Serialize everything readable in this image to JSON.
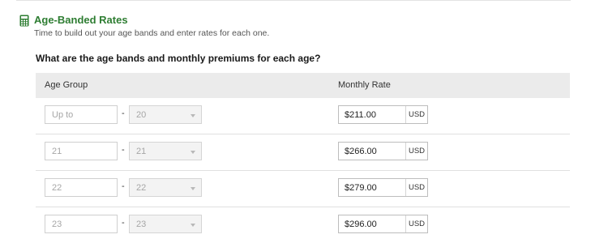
{
  "section": {
    "title": "Age-Banded Rates",
    "subtitle": "Time to build out your age bands and enter rates for each one.",
    "icon": "calculator-icon",
    "accent_color": "#2e7d32"
  },
  "question": "What are the age bands and monthly premiums for each age?",
  "table": {
    "headers": {
      "age_group": "Age Group",
      "monthly_rate": "Monthly Rate"
    },
    "separator": "-",
    "rows": [
      {
        "from_placeholder": "Up to",
        "to": "20",
        "rate": "$211.00",
        "currency": "USD"
      },
      {
        "from_placeholder": "21",
        "to": "21",
        "rate": "$266.00",
        "currency": "USD"
      },
      {
        "from_placeholder": "22",
        "to": "22",
        "rate": "$279.00",
        "currency": "USD"
      },
      {
        "from_placeholder": "23",
        "to": "23",
        "rate": "$296.00",
        "currency": "USD"
      }
    ]
  }
}
